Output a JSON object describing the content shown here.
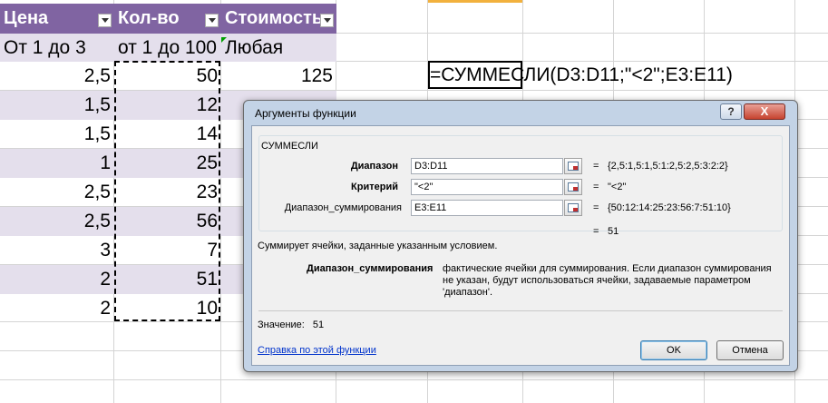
{
  "sheet": {
    "headers": [
      "Цена",
      "Кол-во",
      "Стоимость"
    ],
    "criteria": [
      "От 1 до 3",
      "от 1 до 100",
      "Любая"
    ],
    "rows": [
      {
        "price": "2,5",
        "qty": "50",
        "cost": "125"
      },
      {
        "price": "1,5",
        "qty": "12",
        "cost": ""
      },
      {
        "price": "1,5",
        "qty": "14",
        "cost": ""
      },
      {
        "price": "1",
        "qty": "25",
        "cost": ""
      },
      {
        "price": "2,5",
        "qty": "23",
        "cost": ""
      },
      {
        "price": "2,5",
        "qty": "56",
        "cost": ""
      },
      {
        "price": "3",
        "qty": "7",
        "cost": ""
      },
      {
        "price": "2",
        "qty": "51",
        "cost": ""
      },
      {
        "price": "2",
        "qty": "10",
        "cost": ""
      }
    ],
    "formula": "=СУММЕСЛИ(D3:D11;\"<2\";E3:E11)",
    "header_color": "#8064a2",
    "band_color": "#e4dfec"
  },
  "dialog": {
    "title": "Аргументы функции",
    "help_glyph": "?",
    "close_glyph": "X",
    "function_name": "СУММЕСЛИ",
    "args": [
      {
        "label": "Диапазон",
        "value": "D3:D11",
        "result": "{2,5:1,5:1,5:1:2,5:2,5:3:2:2}"
      },
      {
        "label": "Критерий",
        "value": "\"<2\"",
        "result": "\"<2\""
      },
      {
        "label": "Диапазон_суммирования",
        "value": "E3:E11",
        "result": "{50:12:14:25:23:56:7:51:10}"
      }
    ],
    "eq": "=",
    "total_result": "51",
    "description": "Суммирует ячейки, заданные указанным условием.",
    "arg_help_name": "Диапазон_суммирования",
    "arg_help_text": "фактические ячейки для суммирования. Если диапазон суммирования не указан, будут использоваться ячейки, задаваемые параметром 'диапазон'.",
    "value_label": "Значение:",
    "value": "51",
    "help_link": "Справка по этой функции",
    "ok_label": "OK",
    "cancel_label": "Отмена"
  }
}
